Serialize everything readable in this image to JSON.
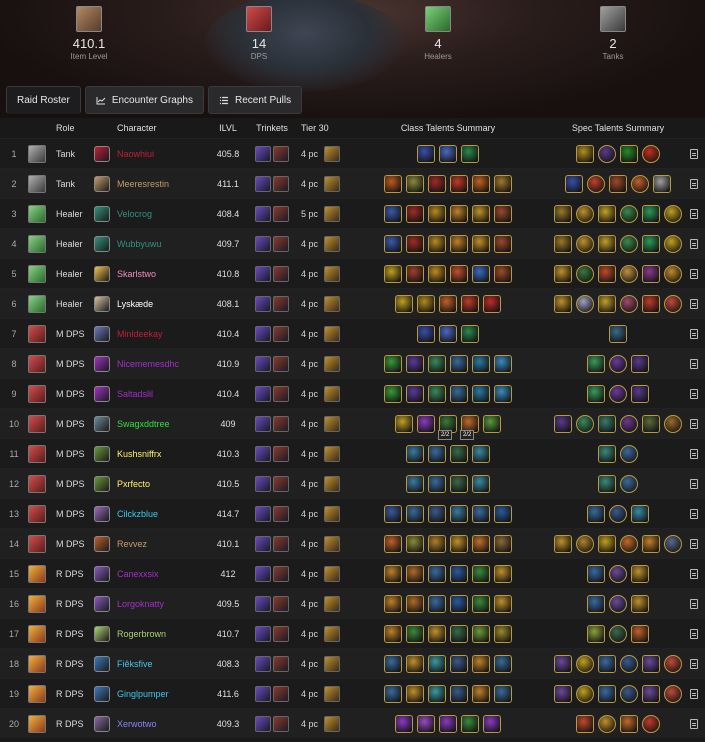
{
  "stats": [
    {
      "value": "410.1",
      "label": "Item Level",
      "icon": "fist-icon",
      "color": "#8a6a52"
    },
    {
      "value": "14",
      "label": "DPS",
      "icon": "sword-icon",
      "color": "#a52c2c"
    },
    {
      "value": "4",
      "label": "Healers",
      "icon": "healing-icon",
      "color": "#3a9a3a"
    },
    {
      "value": "2",
      "label": "Tanks",
      "icon": "shield-icon",
      "color": "#6a6a6a"
    }
  ],
  "tabs": [
    "Raid Roster",
    "Encounter Graphs",
    "Recent Pulls"
  ],
  "headers": {
    "role": "Role",
    "character": "Character",
    "ilvl": "ILVL",
    "trinkets": "Trinkets",
    "tier": "Tier 30",
    "class_talents": "Class Talents Summary",
    "spec_talents": "Spec Talents Summary"
  },
  "rows": [
    {
      "n": "1",
      "role": "Tank",
      "name": "Naowhiui",
      "color": "#c41e3a",
      "ilvl": "405.8",
      "tier": "4 pc",
      "classColor": "#c41e3a",
      "ct": [
        "#3a4fa8",
        "#4a6ac0",
        "#2a8a4a"
      ],
      "st": [
        "#b09020",
        "#5a3a8a",
        "#2a8a2a",
        "#c42e1e"
      ]
    },
    {
      "n": "2",
      "role": "Tank",
      "name": "Meeresrestin",
      "color": "#c69b6d",
      "ilvl": "411.1",
      "tier": "4 pc",
      "classColor": "#c69b6d",
      "ct": [
        "#c25a1e",
        "#8a8a3a",
        "#a02a2a",
        "#c03a2a",
        "#c2621e",
        "#a07a2a"
      ],
      "st": [
        "#3a4fa8",
        "#c0402a",
        "#a04a2a",
        "#c0602a",
        "#a0a0a0"
      ]
    },
    {
      "n": "3",
      "role": "Healer",
      "name": "Velocrog",
      "color": "#33937f",
      "ilvl": "408.4",
      "tier": "5 pc",
      "classColor": "#33937f",
      "ct": [
        "#3a5aa8",
        "#a02a2a",
        "#b88a20",
        "#c0802a",
        "#c0902a",
        "#9a4a2a"
      ],
      "st": [
        "#9a7a2a",
        "#c0902a",
        "#c0a02a",
        "#3a8a4a",
        "#2a9a5a",
        "#c0a020"
      ]
    },
    {
      "n": "4",
      "role": "Healer",
      "name": "Wubbyuwu",
      "color": "#33937f",
      "ilvl": "409.7",
      "tier": "4 pc",
      "classColor": "#33937f",
      "ct": [
        "#3a5aa8",
        "#a02a2a",
        "#b88a20",
        "#c0802a",
        "#c0902a",
        "#9a4a2a"
      ],
      "st": [
        "#9a7a2a",
        "#c0902a",
        "#c0a02a",
        "#3a8a4a",
        "#2a9a5a",
        "#c0a020"
      ]
    },
    {
      "n": "5",
      "role": "Healer",
      "name": "Skarlstwo",
      "color": "#f58cba",
      "ilvl": "410.8",
      "tier": "4 pc",
      "classColor": "#f5c04a",
      "ct": [
        "#c0a020",
        "#a0402a",
        "#c08a20",
        "#c0502a",
        "#3a6ac0",
        "#a04a2a"
      ],
      "st": [
        "#c0902a",
        "#3a7a3a",
        "#c04a2a",
        "#c09040",
        "#8a3a8a",
        "#c08a2a"
      ]
    },
    {
      "n": "6",
      "role": "Healer",
      "name": "Lyskæde",
      "color": "#ffffff",
      "ilvl": "408.1",
      "tier": "4 pc",
      "classColor": "#d8c0a0",
      "ct": [
        "#c0a020",
        "#b08a20",
        "#c0602a",
        "#c03a2a",
        "#c02a2a"
      ],
      "st": [
        "#c0902a",
        "#a0a0c0",
        "#c0a02a",
        "#a04a6a",
        "#c03a2a",
        "#c04a3a"
      ]
    },
    {
      "n": "7",
      "role": "M DPS",
      "name": "Minldeekay",
      "color": "#c41e3a",
      "ilvl": "410.4",
      "tier": "4 pc",
      "classColor": "#6a7ac0",
      "ct": [
        "#3a4fa8",
        "#4a6ac0",
        "#2a8a4a"
      ],
      "st": [
        "#3a6a8a"
      ]
    },
    {
      "n": "8",
      "role": "M DPS",
      "name": "Nicememesdhc",
      "color": "#a330c9",
      "ilvl": "410.9",
      "tier": "4 pc",
      "classColor": "#a330c9",
      "ct": [
        "#3a9a3a",
        "#5a3a9a",
        "#3a8a5a",
        "#3a6a9a",
        "#2a7aa0",
        "#3a8ac0"
      ],
      "st": [
        "#3a9a5a",
        "#6a3a9a",
        "#5a3a8a"
      ]
    },
    {
      "n": "9",
      "role": "M DPS",
      "name": "Saltadslil",
      "color": "#a330c9",
      "ilvl": "410.4",
      "tier": "4 pc",
      "classColor": "#a330c9",
      "ct": [
        "#3a9a3a",
        "#5a3a9a",
        "#3a8a5a",
        "#3a6a9a",
        "#2a7aa0",
        "#3a8ac0"
      ],
      "st": [
        "#3a9a5a",
        "#6a3a9a",
        "#5a3a8a"
      ]
    },
    {
      "n": "10",
      "role": "M DPS",
      "name": "Swagxddtree",
      "color": "#33e03a",
      "ilvl": "409",
      "tier": "4 pc",
      "classColor": "#6a8a9a",
      "ct": [
        "#c0a020",
        "#8a3ac0",
        "#3a7a3a",
        "#c06a2a",
        "#5a9a3a"
      ],
      "st": [
        "#5a3a8a",
        "#3a8a5a",
        "#3a7a6a",
        "#6a3a8a",
        "#5a6a3a",
        "#9a6a2a"
      ]
    },
    {
      "n": "11",
      "role": "M DPS",
      "name": "Kushsniffrx",
      "color": "#fff468",
      "ilvl": "410.3",
      "tier": "4 pc",
      "classColor": "#6a9a3a",
      "ct": [
        "#3a7aa0",
        "#3a6a9a",
        "#3a6a4a",
        "#3a8aa0"
      ],
      "st": [
        "#3a8a7a",
        "#3a6a9a"
      ]
    },
    {
      "n": "12",
      "role": "M DPS",
      "name": "Pxrfecto",
      "color": "#fff468",
      "ilvl": "410.5",
      "tier": "4 pc",
      "classColor": "#6a9a3a",
      "ct": [
        "#3a7aa0",
        "#3a6a9a",
        "#3a6a4a",
        "#3a8aa0"
      ],
      "st": [
        "#3a8a7a",
        "#3a6a9a"
      ]
    },
    {
      "n": "13",
      "role": "M DPS",
      "name": "Cilckzblue",
      "color": "#3fc7eb",
      "ilvl": "414.7",
      "tier": "4 pc",
      "classColor": "#9a6ac0",
      "ct": [
        "#3a5a9a",
        "#3a6a9a",
        "#3a5a8a",
        "#3a7aa0",
        "#3a6aa0",
        "#2a5a9a"
      ],
      "st": [
        "#3a6a9a",
        "#3a5a8a",
        "#3a8aa0"
      ]
    },
    {
      "n": "14",
      "role": "M DPS",
      "name": "Revvez",
      "color": "#c69b6d",
      "ilvl": "410.1",
      "tier": "4 pc",
      "classColor": "#c0602a",
      "ct": [
        "#c0602a",
        "#8a8a3a",
        "#b0802a",
        "#c0902a",
        "#c0702a",
        "#8a6a3a"
      ],
      "st": [
        "#c0902a",
        "#b0802a",
        "#c0a020",
        "#c06a2a",
        "#c0802a",
        "#5a6a8a"
      ]
    },
    {
      "n": "15",
      "role": "R DPS",
      "name": "Canexxsix",
      "color": "#a330c9",
      "ilvl": "412",
      "tier": "4 pc",
      "classColor": "#8a5ac0",
      "ct": [
        "#c0802a",
        "#b06a2a",
        "#3a6aa0",
        "#2a5aa0",
        "#3a8a3a",
        "#c0902a"
      ],
      "st": [
        "#3a6aa0",
        "#6a4a9a",
        "#c0902a"
      ]
    },
    {
      "n": "16",
      "role": "R DPS",
      "name": "Lorgoknatty",
      "color": "#a330c9",
      "ilvl": "409.5",
      "tier": "4 pc",
      "classColor": "#8a5ac0",
      "ct": [
        "#c0802a",
        "#b06a2a",
        "#3a6aa0",
        "#2a5aa0",
        "#3a8a3a",
        "#c0902a"
      ],
      "st": [
        "#3a6aa0",
        "#6a4a9a",
        "#c0902a"
      ]
    },
    {
      "n": "17",
      "role": "R DPS",
      "name": "Rogerbrown",
      "color": "#aad372",
      "ilvl": "410.7",
      "tier": "4 pc",
      "classColor": "#aad372",
      "ct": [
        "#c0802a",
        "#3a8a3a",
        "#c0902a",
        "#3a6a4a",
        "#6a9a3a",
        "#9a8a2a"
      ],
      "st": [
        "#8aa03a",
        "#3a6a4a",
        "#c0602a"
      ]
    },
    {
      "n": "18",
      "role": "R DPS",
      "name": "Fiêksfive",
      "color": "#3fc7eb",
      "ilvl": "408.3",
      "tier": "4 pc",
      "classColor": "#3a7ac0",
      "ct": [
        "#3a6aa0",
        "#c0902a",
        "#3a9aa0",
        "#3a5a8a",
        "#c0802a",
        "#3a6a9a"
      ],
      "st": [
        "#6a4a9a",
        "#c0a020",
        "#3a6aa0",
        "#3a5a8a",
        "#6a4a9a",
        "#c04a3a"
      ]
    },
    {
      "n": "19",
      "role": "R DPS",
      "name": "Ginglpumper",
      "color": "#3fc7eb",
      "ilvl": "411.6",
      "tier": "4 pc",
      "classColor": "#3a7ac0",
      "ct": [
        "#3a6aa0",
        "#c0902a",
        "#3a9aa0",
        "#3a5a8a",
        "#c0802a",
        "#3a6a9a"
      ],
      "st": [
        "#6a4a9a",
        "#c0a020",
        "#3a6aa0",
        "#3a5a8a",
        "#6a4a9a",
        "#c04a3a"
      ]
    },
    {
      "n": "20",
      "role": "R DPS",
      "name": "Xerwotwo",
      "color": "#8788ee",
      "ilvl": "409.3",
      "tier": "4 pc",
      "classColor": "#8a6aa0",
      "ct": [
        "#8a3ac0",
        "#9a4ac0",
        "#8a3ac0",
        "#3a8a3a",
        "#8a3ac0"
      ],
      "st": [
        "#c04a2a",
        "#c0902a",
        "#c06a2a",
        "#c03a2a"
      ]
    }
  ],
  "badges": {
    "row10": [
      "2/2",
      "2/2"
    ]
  }
}
